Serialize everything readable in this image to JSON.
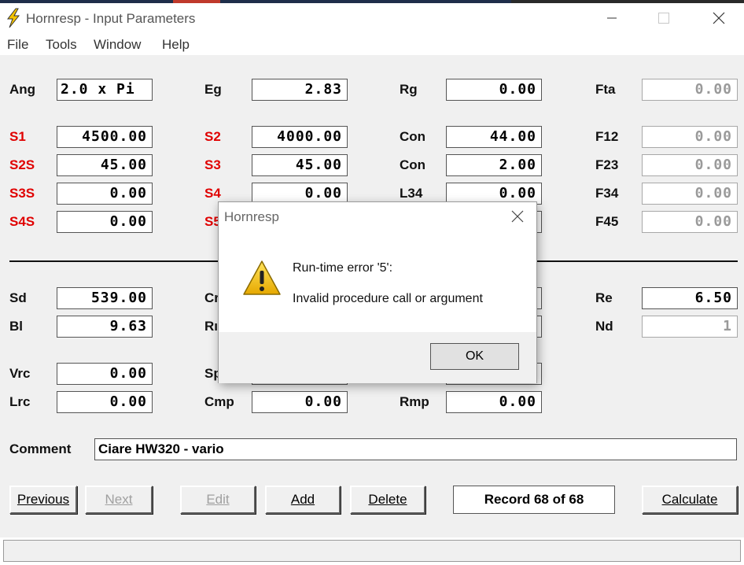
{
  "window": {
    "title": "Hornresp - Input Parameters"
  },
  "menu": {
    "file": "File",
    "tools": "Tools",
    "window": "Window",
    "help": "Help"
  },
  "labels": {
    "ang": "Ang",
    "eg": "Eg",
    "rg": "Rg",
    "fta": "Fta",
    "s1": "S1",
    "s2": "S2",
    "con1": "Con",
    "f12": "F12",
    "s2s": "S2S",
    "s3": "S3",
    "con2": "Con",
    "f23": "F23",
    "s3s": "S3S",
    "s4": "S4",
    "l34": "L34",
    "f34": "F34",
    "s4s": "S4S",
    "s5": "S5",
    "f45": "F45",
    "sd": "Sd",
    "cm": "Cr",
    "re": "Re",
    "bl": "Bl",
    "rm": "Rı",
    "nd": "Nd",
    "vrc": "Vrc",
    "sp": "Sp",
    "lrc": "Lrc",
    "cmp": "Cmp",
    "rmp": "Rmp",
    "comment": "Comment"
  },
  "values": {
    "ang": "2.0 x Pi",
    "eg": "2.83",
    "rg": "0.00",
    "fta": "0.00",
    "s1": "4500.00",
    "s2": "4000.00",
    "con1": "44.00",
    "f12": "0.00",
    "s2s": "45.00",
    "s3": "45.00",
    "con2": "2.00",
    "f23": "0.00",
    "s3s": "0.00",
    "s4": "0.00",
    "l34": "0.00",
    "f34": "0.00",
    "s4s": "0.00",
    "f45": "0.00",
    "sd": "539.00",
    "re": "6.50",
    "bl": "9.63",
    "nd": "1",
    "vrc": "0.00",
    "lrc": "0.00",
    "cmp": "0.00",
    "rmp": "0.00",
    "comment": "Ciare HW320 - vario"
  },
  "buttons": {
    "previous": "Previous",
    "next": "Next",
    "edit": "Edit",
    "add": "Add",
    "delete": "Delete",
    "calculate": "Calculate"
  },
  "record": "Record 68 of 68",
  "dialog": {
    "title": "Hornresp",
    "line1": "Run-time error '5':",
    "line2": "Invalid procedure call or argument",
    "ok": "OK"
  },
  "colors": {
    "label_red": "#e00000",
    "client_bg": "#f0f0f0",
    "warning_yellow": "#f5c400"
  }
}
